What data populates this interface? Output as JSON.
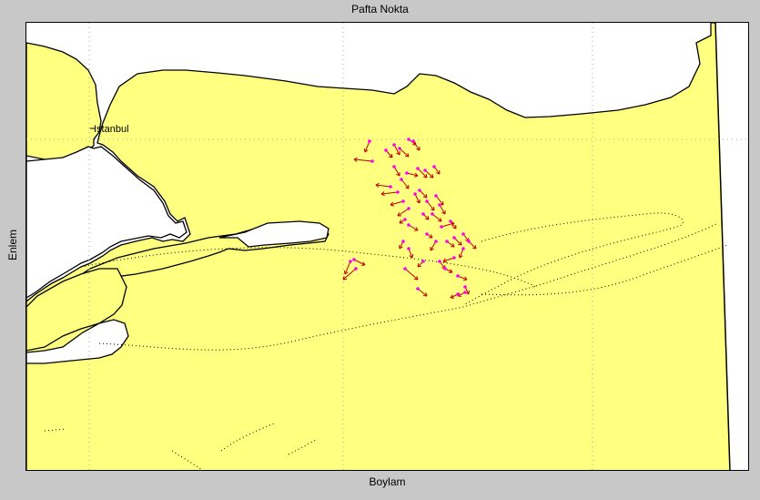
{
  "figure": {
    "title": "Pafta Nokta",
    "x_axis_label": "Boylam",
    "y_axis_label": "Enlem"
  },
  "map": {
    "place_labels": [
      {
        "name": "Istanbul"
      }
    ],
    "colors": {
      "land": "#ffff80",
      "sea": "#ffffff",
      "coastline": "#000000",
      "arrow": "#c00000",
      "station": "#ff00ff",
      "grid": "#aaaaaa",
      "figure_background": "#c8c8c8"
    },
    "grid": true
  }
}
